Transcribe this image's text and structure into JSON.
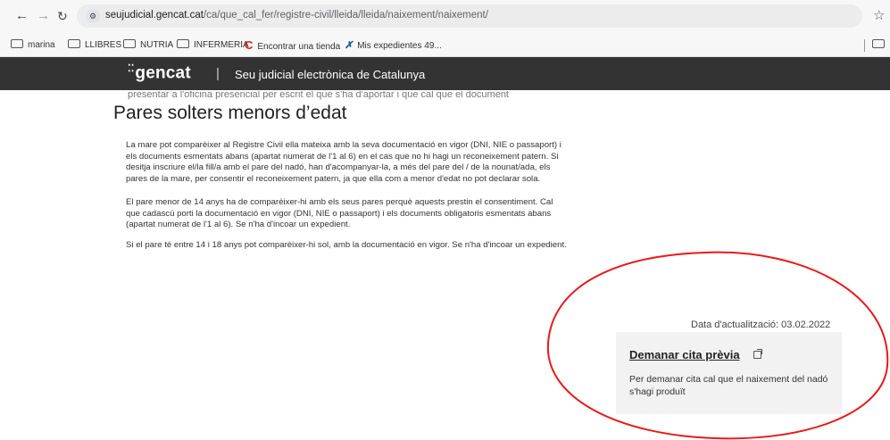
{
  "browser": {
    "url_host": "seujudicial.gencat.cat",
    "url_path": "/ca/que_cal_fer/registre-civil/lleida/lleida/naixement/naixement/",
    "bookmarks": [
      "marina",
      "LLIBRES",
      "NUTRIA",
      "INFERMERIA",
      "Encontrar una tienda",
      "Mis expedientes 49..."
    ]
  },
  "header": {
    "logo": "gencat",
    "separator": "|",
    "title": "Seu judicial electrònica de Catalunya"
  },
  "content": {
    "cut_line": "presentar a l'oficina presencial per escrit el que s'ha d'aportar i que cal que el document",
    "heading": "Pares solters menors d’edat",
    "paragraphs": [
      "La mare pot comparèixer al Registre Civil ella mateixa amb la seva documentació en vigor (DNI, NIE o passaport) i els documents esmentats abans (apartat numerat de l'1 al 6) en el cas que no hi hagi un reconeixement patern. Si desitja inscriure el/la fill/a amb el pare del nadó, han d'acompanyar-la, a més del pare del / de la nounat/ada, els pares de la mare, per consentir el reconeixement patern, ja que ella com a menor d'edat no pot declarar sola.",
      "El pare menor de 14 anys ha de comparèixer-hi amb els seus pares perquè aquests prestin el consentiment. Cal que cadascú porti la documentació en vigor (DNI, NIE o passaport) i els documents obligatoris esmentats abans (apartat numerat de l'1 al 6). Se n'ha d'incoar un expedient.",
      "Si el pare té entre 14 i 18 anys pot comparèixer-hi sol, amb la documentació en vigor. Se n'ha d'incoar un expedient."
    ]
  },
  "update_date": "Data d'actualització: 03.02.2022",
  "cita_card": {
    "link": "Demanar cita prèvia",
    "description": "Per demanar cita cal que el naixement del nadó s'hagi produït"
  },
  "colors": {
    "header_bg": "#333333",
    "annotation": "#e8191c"
  }
}
